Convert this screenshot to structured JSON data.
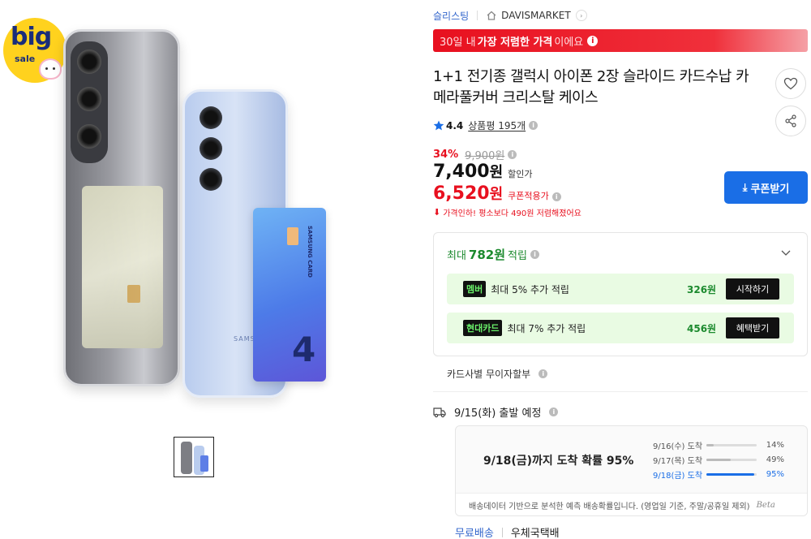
{
  "gallery": {
    "badge_big": "big",
    "badge_sale": "sale",
    "phone_brand": "SAMSUNG",
    "card_brand": "SAMSUNG CARD",
    "card_number_glyph": "4"
  },
  "breadcrumb": {
    "category": "슬리스팅",
    "store": "DAVISMARKET",
    "home_icon": "home-icon",
    "arrow_icon": "chevron-right-icon"
  },
  "promo": {
    "prefix": "30일 내",
    "highlight": "가장 저렴한 가격",
    "suffix": "이에요",
    "color": "#e8101f"
  },
  "product": {
    "title": "1+1 전기종 갤럭시 아이폰 2장 슬라이드 카드수납 카메라풀커버 크리스탈 케이스",
    "rating": "4.4",
    "reviews_label": "상품평 195개"
  },
  "price": {
    "discount_pct": "34%",
    "original": "9,900원",
    "sale_amount": "7,400",
    "sale_unit": "원",
    "sale_tag": "할인가",
    "coupon_amount": "6,520",
    "coupon_unit": "원",
    "coupon_tag": "쿠폰적용가",
    "drop_note": "가격인하! 평소보다 490원 저렴해졌어요",
    "coupon_button": "쿠폰받기",
    "accent": "#e8101f",
    "button_color": "#1a6ee6"
  },
  "rewards": {
    "head_prefix": "최대",
    "head_amount": "782원",
    "head_suffix": "적립",
    "rows": [
      {
        "badge": "멤버",
        "desc": "최대 5% 추가 적립",
        "amount": "326원",
        "action": "시작하기"
      },
      {
        "badge": "현대카드",
        "desc": "최대 7% 추가 적립",
        "amount": "456원",
        "action": "혜택받기"
      }
    ],
    "color": "#1c8a2e"
  },
  "installment": "카드사별 무이자할부",
  "shipping": {
    "departure": "9/15(화) 출발 예정",
    "probability": "9/18(금)까지 도착 확률 95%",
    "estimates": [
      {
        "date": "9/16(수) 도착",
        "pct": "14%",
        "value": 0.14
      },
      {
        "date": "9/17(목) 도착",
        "pct": "49%",
        "value": 0.49
      },
      {
        "date": "9/18(금) 도착",
        "pct": "95%",
        "value": 0.95
      }
    ],
    "footnote": "배송데이터 기반으로 분석한 예측 배송확률입니다. (영업일 기준, 주말/공휴일 제외)",
    "beta": "Beta",
    "free_label": "무료배송",
    "carrier": "우체국택배"
  }
}
